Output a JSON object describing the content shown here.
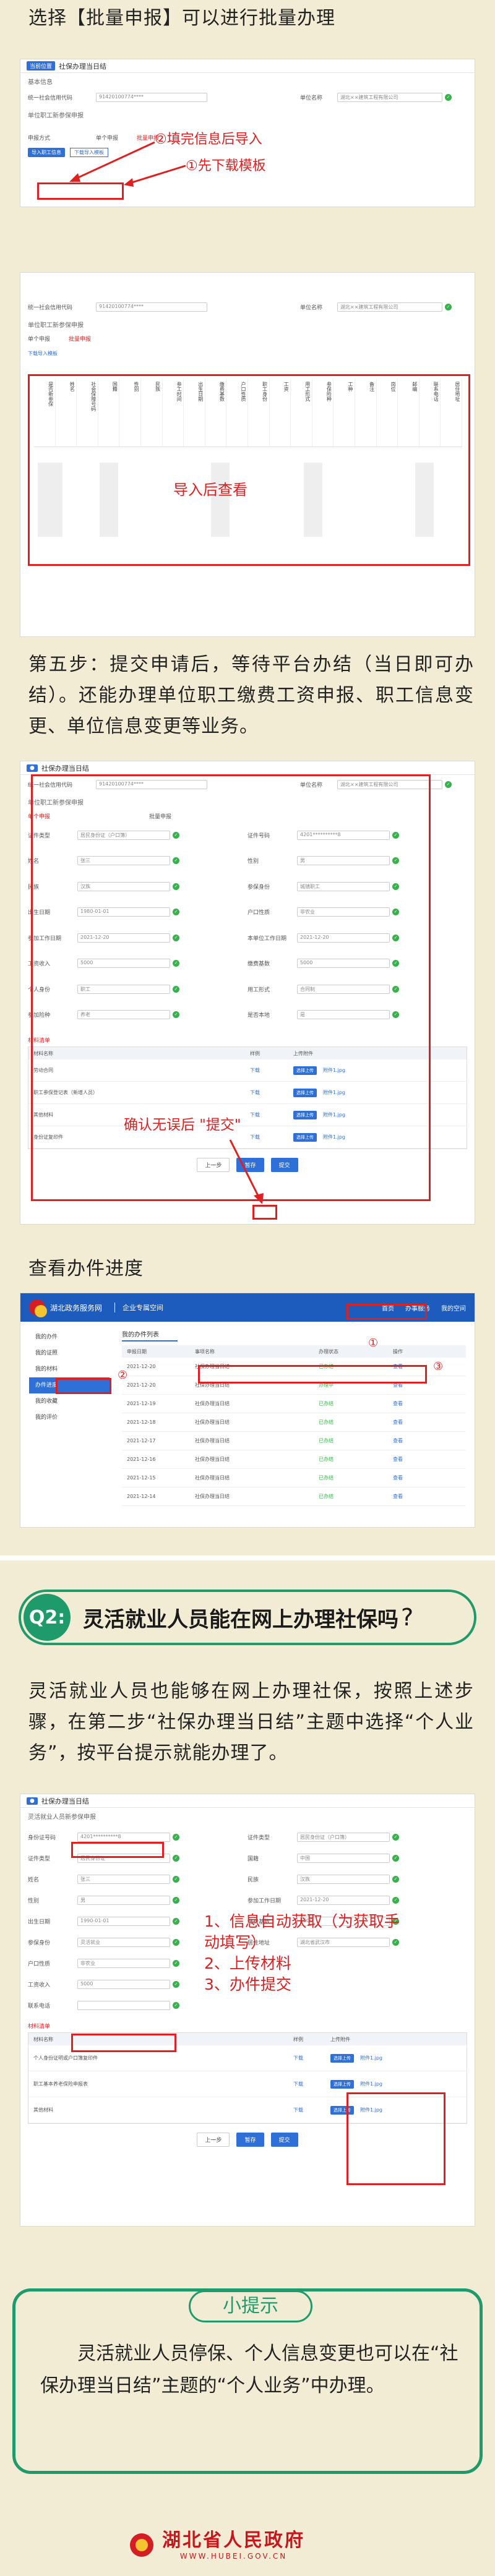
{
  "step_batch": {
    "heading": "选择【批量申报】可以进行批量办理",
    "window_title": "社保办理当日结",
    "window_tag": "当前位置",
    "section_basic": "基本信息",
    "field1_label": "统一社会信用代码",
    "field1_value": "91420100774****",
    "field2_label": "单位名称",
    "field2_value": "湖北××建筑工程有限公司",
    "section_staff": "单位职工新参保申报",
    "mode_label": "申报方式",
    "mode_opt1": "单个申报",
    "mode_opt2": "批量申报",
    "import_button": "导入职工信息",
    "template_button": "下载导入模板",
    "callout_fill": "②填完信息后导入",
    "callout_download": "①先下载模板"
  },
  "step_import": {
    "field1_label": "统一社会信用代码",
    "field1_value": "91420100774****",
    "field2_label": "单位名称",
    "field2_value": "湖北××建筑工程有限公司",
    "section_staff": "单位职工新参保申报",
    "mode_opt1": "单个申报",
    "mode_opt2": "批量申报",
    "template_link": "下载导入模板",
    "headers": [
      "是否新参保",
      "姓名",
      "社会保障号码",
      "国籍",
      "性别",
      "民族",
      "参工时间",
      "出生日期",
      "缴费基数",
      "户口性质",
      "职工身份",
      "工资",
      "用工形式",
      "参保险种",
      "工种",
      "备注",
      "岗位",
      "邮编",
      "联系电话",
      "居住地址"
    ],
    "callout": "导入后查看"
  },
  "step_five": {
    "paragraph": "第五步：提交申请后，等待平台办结（当日即可办结）。还能办理单位职工缴费工资申报、职工信息变更、单位信息变更等业务。"
  },
  "step_submit": {
    "window_title": "社保办理当日结",
    "field1_label": "统一社会信用代码",
    "field1_value": "91420100774****",
    "field2_label": "单位名称",
    "field2_value": "湖北××建筑工程有限公司",
    "section_staff": "单位职工新参保申报",
    "mode_opt1": "单个申报",
    "mode_opt2": "批量申报",
    "form_labels": [
      "证件类型",
      "证件号码",
      "姓名",
      "性别",
      "民族",
      "参保身份",
      "出生日期",
      "户口性质",
      "参加工作日期",
      "本单位工作日期",
      "工资收入",
      "缴费基数",
      "个人身份",
      "用工形式",
      "参加险种",
      "是否本地"
    ],
    "form_values": [
      "居民身份证（户口簿）",
      "4201**********8",
      "张三",
      "男",
      "汉族",
      "城镇职工",
      "1980-01-01",
      "非农业",
      "2021-12-20",
      "2021-12-20",
      "5000",
      "5000",
      "职工",
      "合同制",
      "养老",
      "是"
    ],
    "material_title": "材料清单",
    "material_cols": [
      "材料名称",
      "样例",
      "上传附件"
    ],
    "materials": [
      "劳动合同",
      "职工参保登记表（新增人员）",
      "其他材料",
      "身份证复印件"
    ],
    "sample_label": "下载",
    "upload_label": "选择上传",
    "file_label": "附件1.jpg",
    "prev_button": "上一步",
    "save_button": "暂存",
    "submit_button": "提交",
    "callout": "确认无误后 \"提交\""
  },
  "progress": {
    "heading": "查看办件进度",
    "site_name": "湖北政务服务网",
    "site_sub": "企业专属空间",
    "nav_items": [
      "首页",
      "办事服务",
      "我的空间"
    ],
    "side_items": [
      "我的办件",
      "我的证照",
      "我的材料",
      "办件进度",
      "我的收藏",
      "我的评价"
    ],
    "table_title": "我的办件列表",
    "cols": [
      "申报日期",
      "事项名称",
      "办理状态",
      "操作"
    ],
    "rows": [
      {
        "date": "2021-12-20",
        "name": "社保办理当日结",
        "status": "已办结",
        "op": "查看"
      },
      {
        "date": "2021-12-20",
        "name": "社保办理当日结",
        "status": "办理中",
        "op": "查看"
      },
      {
        "date": "2021-12-19",
        "name": "社保办理当日结",
        "status": "已办结",
        "op": "查看"
      },
      {
        "date": "2021-12-18",
        "name": "社保办理当日结",
        "status": "已办结",
        "op": "查看"
      },
      {
        "date": "2021-12-17",
        "name": "社保办理当日结",
        "status": "已办结",
        "op": "查看"
      },
      {
        "date": "2021-12-16",
        "name": "社保办理当日结",
        "status": "已办结",
        "op": "查看"
      },
      {
        "date": "2021-12-15",
        "name": "社保办理当日结",
        "status": "已办结",
        "op": "查看"
      },
      {
        "date": "2021-12-14",
        "name": "社保办理当日结",
        "status": "已办结",
        "op": "查看"
      }
    ],
    "marker1": "①",
    "marker2": "②",
    "marker3": "③"
  },
  "q2": {
    "badge": "Q2:",
    "question": "灵活就业人员能在网上办理社保吗",
    "qmark": "?",
    "paragraph": "灵活就业人员也能够在网上办理社保，按照上述步骤，在第二步“社保办理当日结”主题中选择“个人业务”，按平台提示就能办理了。"
  },
  "personal": {
    "window_title": "社保办理当日结",
    "section": "灵活就业人员新参保申报",
    "labels_left": [
      "身份证号码",
      "证件类型",
      "姓名",
      "性别",
      "出生日期",
      "参保身份",
      "户口性质",
      "工资收入",
      "联系电话"
    ],
    "values_left": [
      "4201**********8",
      "居民身份证",
      "张三",
      "男",
      "1990-01-01",
      "灵活就业",
      "非农业",
      "5000",
      ""
    ],
    "labels_right": [
      "证件类型",
      "国籍",
      "民族",
      "参加工作日期",
      "缴费基数",
      "居住地址"
    ],
    "values_right": [
      "居民身份证（户口簿）",
      "中国",
      "汉族",
      "2021-12-20",
      "5000",
      "湖北省武汉市"
    ],
    "callout_lines": [
      "1、信息自动获取（为获取手",
      "动填写）",
      "2、上传材料",
      "3、办件提交"
    ],
    "material_title": "材料清单",
    "material_cols": [
      "材料名称",
      "样例",
      "上传附件"
    ],
    "materials": [
      "个人身份证明或户口簿复印件",
      "职工基本养老保险申报表",
      "其他材料"
    ],
    "sample_label": "下载",
    "upload_label": "选择上传",
    "file_label": "附件1.jpg",
    "prev_button": "上一步",
    "save_button": "暂存",
    "submit_button": "提交"
  },
  "tip": {
    "title": "小提示",
    "text": "灵活就业人员停保、个人信息变更也可以在“社保办理当日结”主题的“个人业务”中办理。"
  },
  "footer": {
    "name": "湖北省人民政府",
    "url": "WWW.HUBEI.GOV.CN"
  },
  "colors": {
    "accent_red": "#e02020",
    "green": "#1f9b6b",
    "blue": "#2f6fd8",
    "background": "#f3ecd5"
  }
}
